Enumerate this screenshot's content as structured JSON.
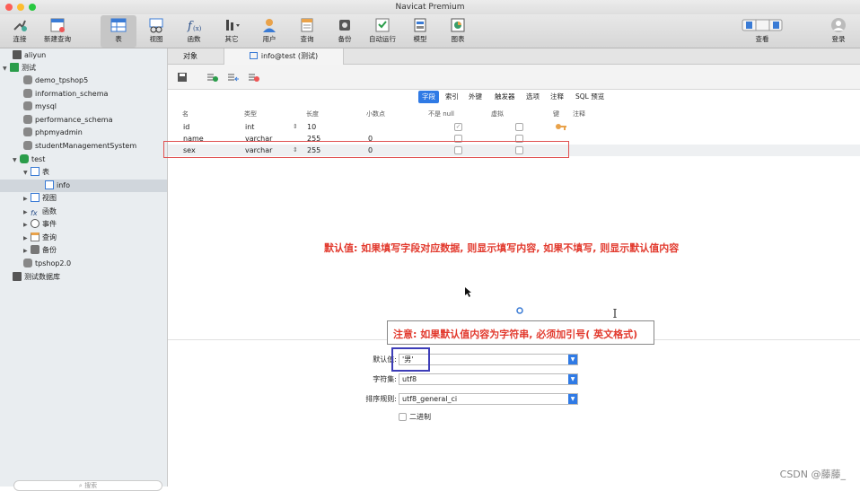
{
  "window": {
    "title": "Navicat Premium"
  },
  "toolbar": {
    "items": [
      {
        "label": "连接",
        "icon": "connect-icon"
      },
      {
        "label": "新建查询",
        "icon": "new-query-icon"
      },
      {
        "label": "表",
        "icon": "table-icon"
      },
      {
        "label": "视图",
        "icon": "view-icon"
      },
      {
        "label": "函数",
        "icon": "function-icon"
      },
      {
        "label": "其它",
        "icon": "other-icon"
      },
      {
        "label": "用户",
        "icon": "user-icon"
      },
      {
        "label": "查询",
        "icon": "query-icon"
      },
      {
        "label": "备份",
        "icon": "backup-icon"
      },
      {
        "label": "自动运行",
        "icon": "automation-icon"
      },
      {
        "label": "模型",
        "icon": "model-icon"
      },
      {
        "label": "图表",
        "icon": "chart-icon"
      }
    ],
    "view_label": "查看",
    "login_label": "登录"
  },
  "sidebar": {
    "items": [
      {
        "label": "aliyun"
      },
      {
        "label": "测试"
      },
      {
        "label": "demo_tpshop5"
      },
      {
        "label": "information_schema"
      },
      {
        "label": "mysql"
      },
      {
        "label": "performance_schema"
      },
      {
        "label": "phpmyadmin"
      },
      {
        "label": "studentManagementSystem"
      },
      {
        "label": "test"
      },
      {
        "label": "表"
      },
      {
        "label": "info"
      },
      {
        "label": "视图"
      },
      {
        "label": "函数"
      },
      {
        "label": "事件"
      },
      {
        "label": "查询"
      },
      {
        "label": "备份"
      },
      {
        "label": "tpshop2.0"
      },
      {
        "label": "测试数据库"
      }
    ],
    "search_placeholder": "搜索"
  },
  "tabs": {
    "objects": "对象",
    "current": "info@test (测试)"
  },
  "design_tabs": [
    "字段",
    "索引",
    "外键",
    "触发器",
    "选项",
    "注释",
    "SQL 预览"
  ],
  "columns": {
    "name": "名",
    "type": "类型",
    "length": "长度",
    "decimals": "小数点",
    "not_null": "不是 null",
    "virtual": "虚拟",
    "key": "键",
    "comment": "注释"
  },
  "rows": [
    {
      "name": "id",
      "type": "int",
      "length": "10",
      "decimals": ""
    },
    {
      "name": "name",
      "type": "varchar",
      "length": "255",
      "decimals": "0"
    },
    {
      "name": "sex",
      "type": "varchar",
      "length": "255",
      "decimals": "0"
    }
  ],
  "annotations": {
    "note1": "默认值: 如果填写字段对应数据, 则显示填写内容, 如果不填写, 则显示默认值内容",
    "note2": "注意: 如果默认值内容为字符串, 必须加引号( 英文格式)"
  },
  "properties": {
    "default_label": "默认值:",
    "default_value": "'男'",
    "charset_label": "字符集:",
    "charset_value": "utf8",
    "collation_label": "排序规则:",
    "collation_value": "utf8_general_ci",
    "binary_label": "二进制"
  },
  "watermark": "CSDN @藤藤_"
}
